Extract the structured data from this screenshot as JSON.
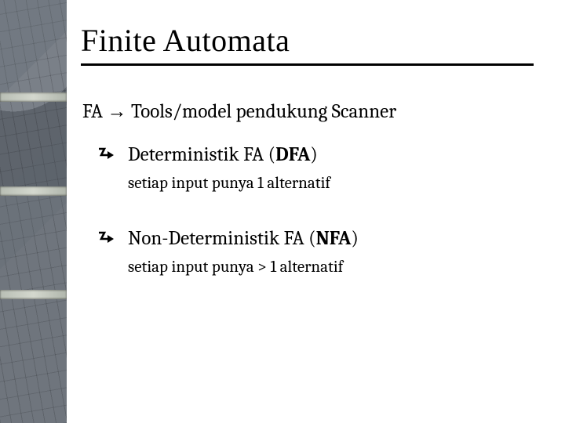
{
  "title": "Finite Automata",
  "intro": {
    "prefix": "FA ",
    "arrow": "→",
    "suffix": " Tools/model pendukung Scanner"
  },
  "items": [
    {
      "label_pre": "Deterministik FA (",
      "label_bold": "DFA",
      "label_post": ")",
      "detail": "setiap input punya 1 alternatif"
    },
    {
      "label_pre": "Non-Deterministik FA (",
      "label_bold": "NFA",
      "label_post": ")",
      "detail": "setiap input punya > 1 alternatif"
    }
  ]
}
